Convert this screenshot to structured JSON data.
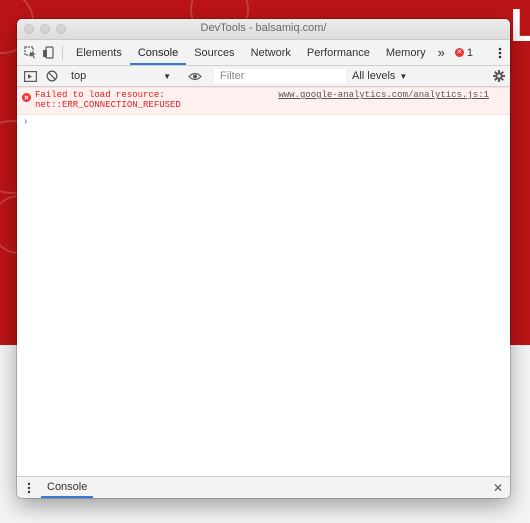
{
  "window": {
    "title": "DevTools - balsamiq.com/"
  },
  "tabs": [
    {
      "label": "Elements"
    },
    {
      "label": "Console",
      "active": true
    },
    {
      "label": "Sources"
    },
    {
      "label": "Network"
    },
    {
      "label": "Performance"
    },
    {
      "label": "Memory"
    }
  ],
  "tabs_overflow": "»",
  "error_count": "1",
  "console_toolbar": {
    "context": "top",
    "filter_placeholder": "Filter",
    "levels": "All levels"
  },
  "messages": [
    {
      "level": "error",
      "text": "Failed to load resource:\nnet::ERR_CONNECTION_REFUSED",
      "source": "www.google-analytics.com/analytics.js:1"
    }
  ],
  "prompt_symbol": "›",
  "drawer": {
    "tab_label": "Console",
    "close": "✕"
  },
  "colors": {
    "background_red": "#bb1416",
    "accent_blue": "#3879d9",
    "error_red": "#e0201e"
  }
}
